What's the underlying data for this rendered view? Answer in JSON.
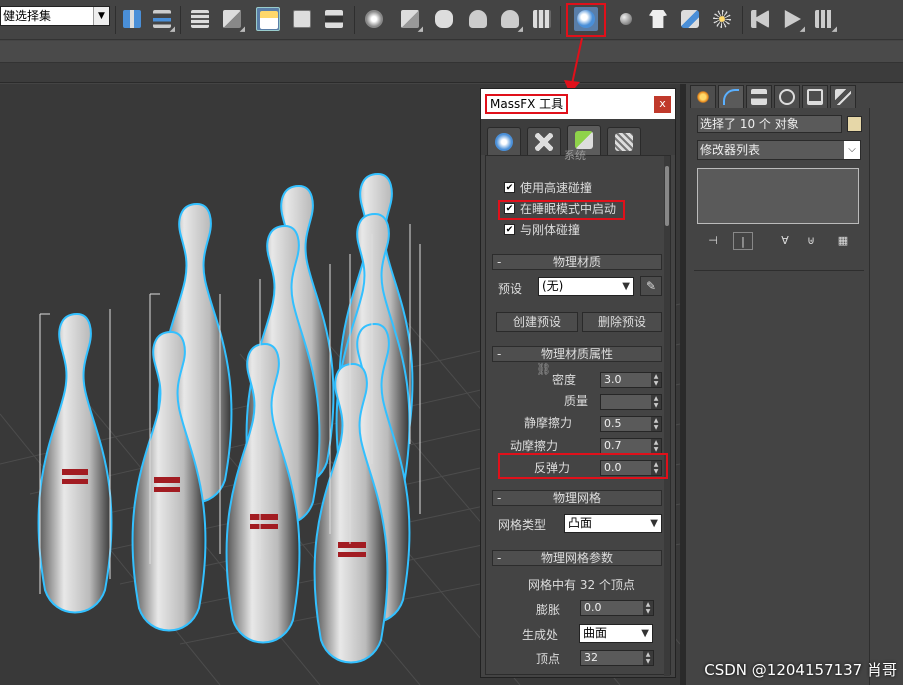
{
  "toolbar": {
    "selection_set": "健选择集",
    "icons": [
      "mirror-icon",
      "align-icon",
      "layer-manager-icon",
      "scene-explorer-icon",
      "layer-explorer-icon",
      "curve-editor-icon",
      "schematic-view-icon",
      "material-editor-icon",
      "render-setup-icon",
      "rendered-frame-icon",
      "render-icon",
      "render-iterative-icon",
      "environment-icon",
      "massfx-tools-icon",
      "sphere-icon",
      "cloth-icon",
      "mcg-icon",
      "explode-icon",
      "anim-start-icon",
      "anim-play-icon",
      "anim-record-icon"
    ]
  },
  "massfx": {
    "title": "MassFX 工具",
    "close": "x",
    "tabs": [
      "world-params",
      "simulation-tools",
      "multi-object-editor",
      "display-options"
    ],
    "collapsed_heading": "系统",
    "checks": [
      {
        "label": "使用高速碰撞",
        "checked": true
      },
      {
        "label": "在睡眠模式中启动",
        "checked": true
      },
      {
        "label": "与刚体碰撞",
        "checked": true
      }
    ],
    "phys_material": {
      "heading": "物理材质",
      "preset_label": "预设",
      "preset_value": "(无)",
      "create_btn": "创建预设",
      "delete_btn": "删除预设"
    },
    "phys_props": {
      "heading": "物理材质属性",
      "density_label": "密度",
      "density": "3.0",
      "mass_label": "质量",
      "mass": "",
      "static_friction_label": "静摩擦力",
      "static_friction": "0.5",
      "dynamic_friction_label": "动摩擦力",
      "dynamic_friction": "0.7",
      "bounciness_label": "反弹力",
      "bounciness": "0.0"
    },
    "phys_mesh": {
      "heading": "物理网格",
      "type_label": "网格类型",
      "type_value": "凸面"
    },
    "mesh_params": {
      "heading": "物理网格参数",
      "vertex_info": "网格中有 32 个顶点",
      "inflation_label": "膨胀",
      "inflation": "0.0",
      "generate_label": "生成处",
      "generate_value": "曲面",
      "vertices_label": "顶点",
      "vertices": "32"
    }
  },
  "command_panel": {
    "tabs": [
      "create",
      "modify",
      "hierarchy",
      "motion",
      "display",
      "utilities"
    ],
    "selection_name": "选择了 10 个 对象",
    "swatch_color": "#e6d7a8",
    "modifier_list": "修改器列表"
  },
  "watermark": "CSDN @1204157137 肖哥"
}
